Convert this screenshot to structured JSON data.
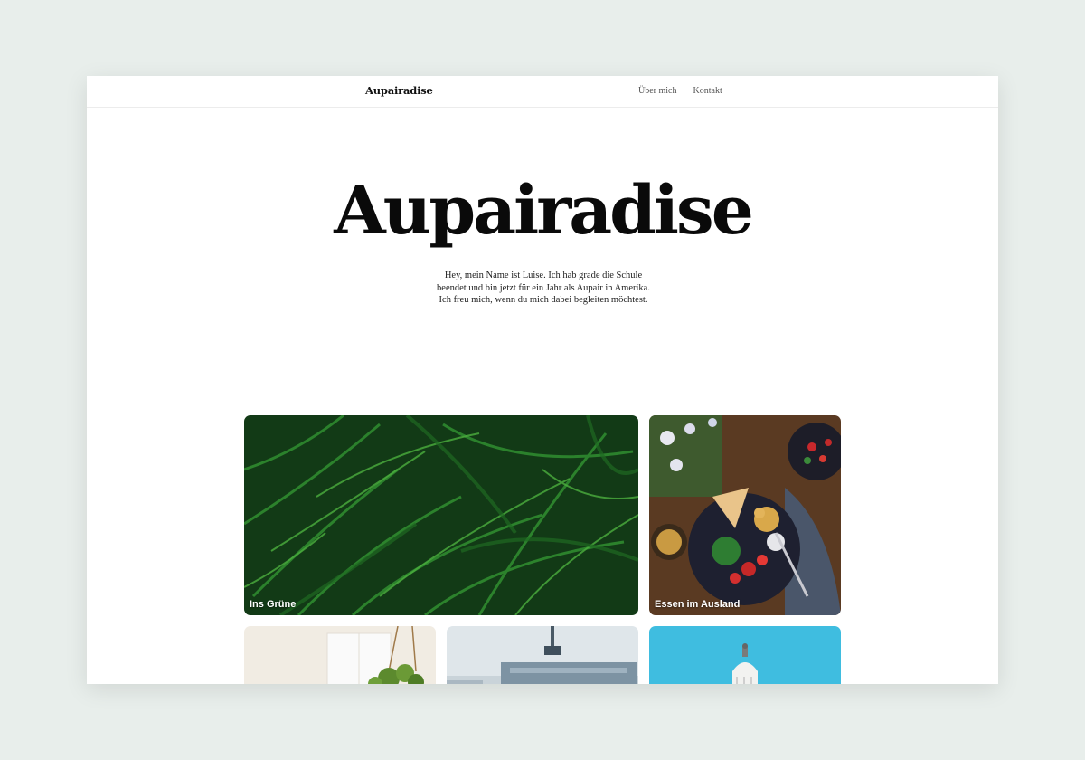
{
  "nav": {
    "brand": "Aupairadise",
    "links": [
      "Über mich",
      "Kontakt"
    ]
  },
  "hero": {
    "title": "Aupairadise",
    "intro": "Hey, mein Name ist Luise. Ich hab grade die Schule beendet und bin jetzt für ein Jahr als Aupair in Amerika. Ich freu mich, wenn du mich dabei begleiten möchtest."
  },
  "cards": [
    {
      "label": "Ins Grüne",
      "image": "fern-leaves"
    },
    {
      "label": "Essen im Ausland",
      "image": "salad-bowl"
    },
    {
      "label": "",
      "image": "hanging-plant-room"
    },
    {
      "label": "",
      "image": "city-skyline"
    },
    {
      "label": "",
      "image": "capitol-dome"
    }
  ],
  "colors": {
    "background": "#e8eeeb",
    "page": "#ffffff",
    "text": "#0a0a0a"
  }
}
